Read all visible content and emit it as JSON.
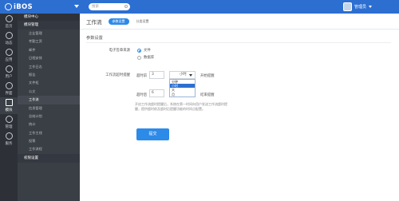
{
  "topbar": {
    "logo": "iBOS",
    "search_placeholder": "搜索",
    "username": "管理员"
  },
  "rail": [
    {
      "label": "首页",
      "icon": "home-icon"
    },
    {
      "label": "动态",
      "icon": "chat-icon"
    },
    {
      "label": "应用",
      "icon": "app-icon"
    },
    {
      "label": "用户",
      "icon": "users-icon"
    },
    {
      "label": "界面",
      "icon": "window-icon"
    },
    {
      "label": "模块",
      "icon": "grid-icon",
      "active": true
    },
    {
      "label": "管理",
      "icon": "gear-icon"
    },
    {
      "label": "服务",
      "icon": "headset-icon"
    }
  ],
  "submenu": {
    "header": "模块中心",
    "group": "模块管理",
    "items": [
      "企业管理",
      "考勤工资",
      "邮件",
      "日程安排",
      "工作日志",
      "报告",
      "文件柜",
      "公文",
      "工作流",
      "信息管理",
      "总结计划",
      "统计",
      "工作主线",
      "投票",
      "工作流程"
    ],
    "active_index": 8,
    "footer": "权限设置"
  },
  "main": {
    "title": "工作流",
    "tabs": [
      {
        "label": "参数设置",
        "active": true
      },
      {
        "label": "分类设置",
        "active": false
      }
    ],
    "section_title": "参数设置",
    "sealing": {
      "label": "电子签章来源",
      "options": [
        {
          "label": "文件",
          "checked": true
        },
        {
          "label": "数据库",
          "checked": false
        }
      ]
    },
    "timeout": {
      "label": "工作流超时提醒",
      "row1_prefix": "超时前",
      "row1_value": "3",
      "row1_unit": "小时",
      "row1_suffix": "开始提醒",
      "row2_prefix": "超时后",
      "row2_value": "6",
      "row2_suffix": "结束提醒",
      "dropdown_options": [
        "分钟",
        "小时",
        "天",
        "月"
      ],
      "dropdown_selected": 1
    },
    "hint": "开启工作流超时提醒后，系统在第一时间向用户发送工作流超时提醒，提供超时前及超时后提醒功能的时间点配置。",
    "submit_label": "提交"
  }
}
